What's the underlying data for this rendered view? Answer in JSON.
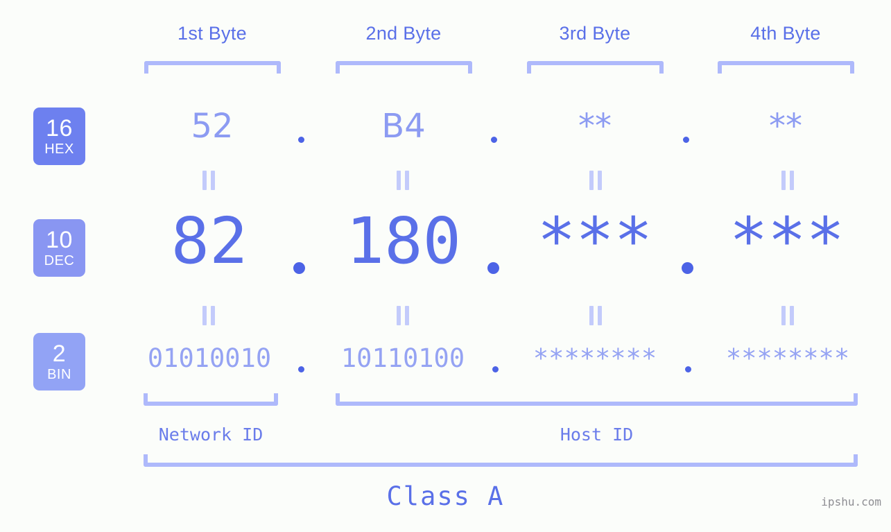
{
  "page": {
    "background_color": "#fbfdfa",
    "accent_color": "#5a70e8",
    "light_accent_color": "#aeb9fb",
    "watermark": "ipshu.com"
  },
  "byte_headers": [
    {
      "label": "1st Byte"
    },
    {
      "label": "2nd Byte"
    },
    {
      "label": "3rd Byte"
    },
    {
      "label": "4th Byte"
    }
  ],
  "rows": [
    {
      "badge_number": "16",
      "badge_name": "HEX",
      "badge_color": "#6d80ef",
      "values": [
        "52",
        "B4",
        "**",
        "**"
      ],
      "separator": "."
    },
    {
      "badge_number": "10",
      "badge_name": "DEC",
      "badge_color": "#8996f2",
      "values": [
        "82",
        "180",
        "***",
        "***"
      ],
      "separator": "."
    },
    {
      "badge_number": "2",
      "badge_name": "BIN",
      "badge_color": "#92a3f5",
      "values": [
        "01010010",
        "10110100",
        "********",
        "********"
      ],
      "separator": "."
    }
  ],
  "equality_mark": "||",
  "id_sections": [
    {
      "label": "Network ID"
    },
    {
      "label": "Host ID"
    }
  ],
  "class_label": "Class A"
}
